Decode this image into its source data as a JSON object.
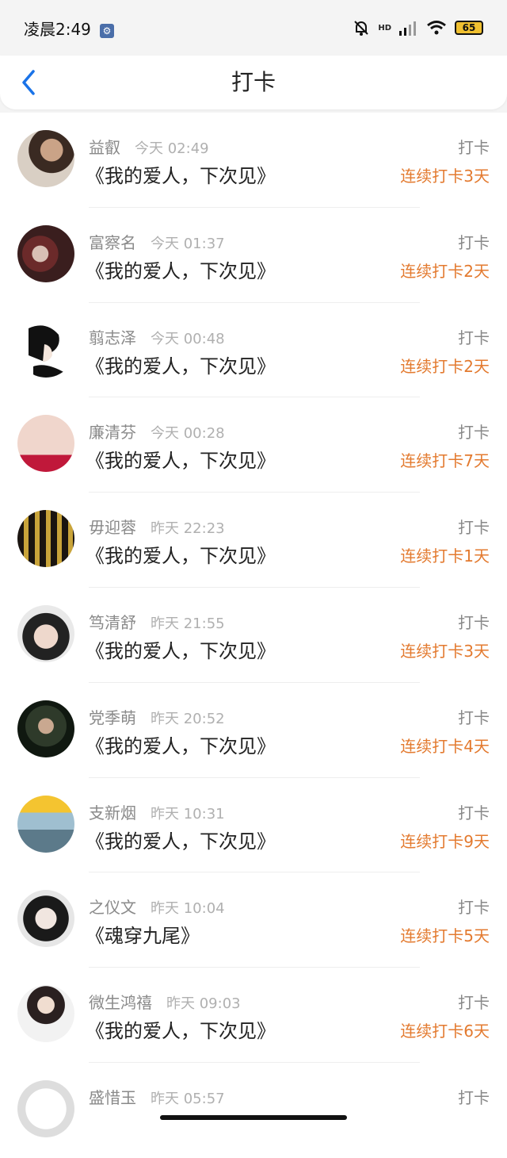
{
  "status": {
    "time": "凌晨2:49",
    "hd": "HD",
    "battery": "65"
  },
  "header": {
    "title": "打卡"
  },
  "colors": {
    "accent": "#1a73e8",
    "streak": "#e37a2f"
  },
  "items": [
    {
      "name": "益叡",
      "time": "今天 02:49",
      "book": "《我的爱人，下次见》",
      "tag": "打卡",
      "streak": "连续打卡3天"
    },
    {
      "name": "富察名",
      "time": "今天 01:37",
      "book": "《我的爱人，下次见》",
      "tag": "打卡",
      "streak": "连续打卡2天"
    },
    {
      "name": "翦志泽",
      "time": "今天 00:48",
      "book": "《我的爱人，下次见》",
      "tag": "打卡",
      "streak": "连续打卡2天"
    },
    {
      "name": "廉清芬",
      "time": "今天 00:28",
      "book": "《我的爱人，下次见》",
      "tag": "打卡",
      "streak": "连续打卡7天"
    },
    {
      "name": "毋迎蓉",
      "time": "昨天 22:23",
      "book": "《我的爱人，下次见》",
      "tag": "打卡",
      "streak": "连续打卡1天"
    },
    {
      "name": "笃清舒",
      "time": "昨天 21:55",
      "book": "《我的爱人，下次见》",
      "tag": "打卡",
      "streak": "连续打卡3天"
    },
    {
      "name": "党季萌",
      "time": "昨天 20:52",
      "book": "《我的爱人，下次见》",
      "tag": "打卡",
      "streak": "连续打卡4天"
    },
    {
      "name": "支新烟",
      "time": "昨天 10:31",
      "book": "《我的爱人，下次见》",
      "tag": "打卡",
      "streak": "连续打卡9天"
    },
    {
      "name": "之仪文",
      "time": "昨天 10:04",
      "book": "《魂穿九尾》",
      "tag": "打卡",
      "streak": "连续打卡5天"
    },
    {
      "name": "微生鸿禧",
      "time": "昨天 09:03",
      "book": "《我的爱人，下次见》",
      "tag": "打卡",
      "streak": "连续打卡6天"
    },
    {
      "name": "盛惜玉",
      "time": "昨天 05:57",
      "book": "",
      "tag": "打卡",
      "streak": ""
    }
  ]
}
